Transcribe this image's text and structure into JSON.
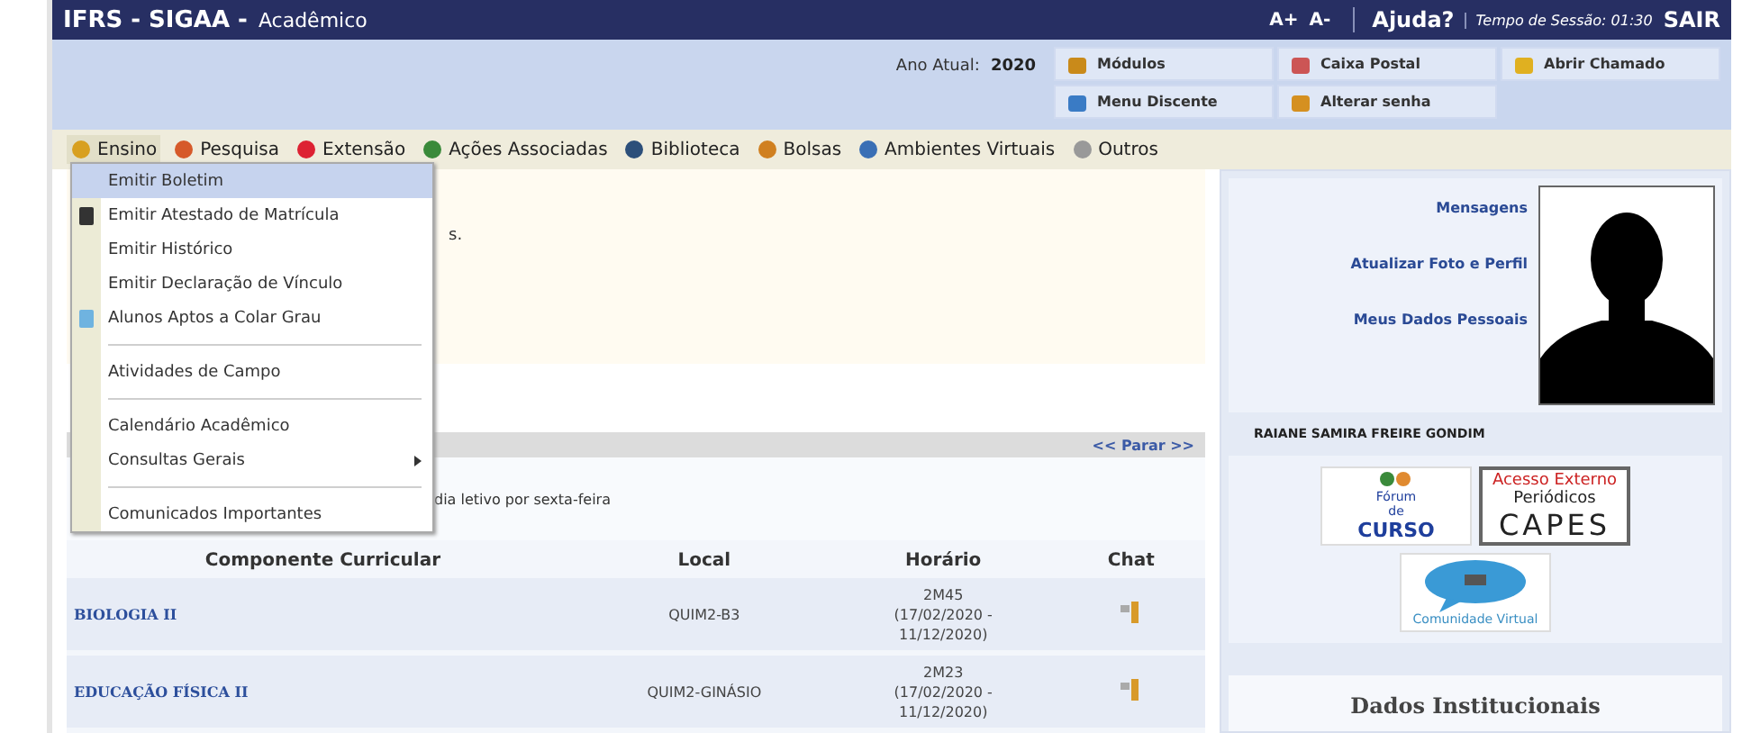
{
  "header": {
    "system": "IFRS - SIGAA -",
    "module": "Acadêmico",
    "font_up": "A+",
    "font_down": "A-",
    "help": "Ajuda?",
    "session": "Tempo de Sessão: 01:30",
    "logout": "SAIR"
  },
  "info_bar": {
    "year_label": "Ano Atual:",
    "year": "2020",
    "buttons": [
      {
        "label": "Módulos"
      },
      {
        "label": "Caixa Postal"
      },
      {
        "label": "Abrir Chamado"
      },
      {
        "label": "Menu Discente"
      },
      {
        "label": "Alterar senha"
      }
    ]
  },
  "menu_bar": [
    {
      "label": "Ensino",
      "selected": true
    },
    {
      "label": "Pesquisa",
      "selected": false
    },
    {
      "label": "Extensão",
      "selected": false
    },
    {
      "label": "Ações Associadas",
      "selected": false
    },
    {
      "label": "Biblioteca",
      "selected": false
    },
    {
      "label": "Bolsas",
      "selected": false
    },
    {
      "label": "Ambientes Virtuais",
      "selected": false
    },
    {
      "label": "Outros",
      "selected": false
    }
  ],
  "dropdown": [
    {
      "label": "Emitir Boletim",
      "kind": "plain",
      "selected": true
    },
    {
      "label": "Emitir Atestado de Matrícula",
      "kind": "icon",
      "selected": false
    },
    {
      "label": "Emitir Histórico",
      "kind": "plain",
      "selected": false
    },
    {
      "label": "Emitir Declaração de Vínculo",
      "kind": "plain",
      "selected": false
    },
    {
      "label": "Alunos Aptos a Colar Grau",
      "kind": "icon",
      "selected": false
    },
    {
      "kind": "separator"
    },
    {
      "label": "Atividades de Campo",
      "kind": "plain",
      "selected": false
    },
    {
      "kind": "separator"
    },
    {
      "label": "Calendário Acadêmico",
      "kind": "plain",
      "selected": false
    },
    {
      "label": "Consultas Gerais",
      "kind": "submenu",
      "selected": false
    },
    {
      "kind": "separator"
    },
    {
      "label": "Comunicados Importantes",
      "kind": "plain",
      "selected": false
    }
  ],
  "notice": {
    "text": "s."
  },
  "classes_panel": {
    "pause": "<< Parar >>",
    "note": "dia letivo por sexta-feira",
    "columns": [
      "Componente Curricular",
      "Local",
      "Horário",
      "Chat"
    ],
    "rows": [
      {
        "component": "BIOLOGIA II",
        "local": "QUIM2-B3",
        "schedule": [
          "2M45",
          "(17/02/2020 -",
          "11/12/2020)"
        ]
      },
      {
        "component": "EDUCAÇÃO FÍSICA II",
        "local": "QUIM2-GINÁSIO",
        "schedule": [
          "2M23",
          "(17/02/2020 -",
          "11/12/2020)"
        ]
      }
    ]
  },
  "profile": {
    "links": [
      "Mensagens",
      "Atualizar Foto e Perfil",
      "Meus Dados Pessoais"
    ],
    "name": "RAIANE SAMIRA FREIRE GONDIM",
    "badges": [
      {
        "kind": "forum",
        "lines": [
          "Fórum",
          "de",
          "CURSO"
        ]
      },
      {
        "kind": "capes",
        "lines": [
          "Acesso Externo",
          "Periódicos",
          "CAPES"
        ]
      },
      {
        "kind": "community",
        "lines": [
          "Comunidade Virtual"
        ]
      }
    ],
    "section_title": "Dados Institucionais"
  }
}
